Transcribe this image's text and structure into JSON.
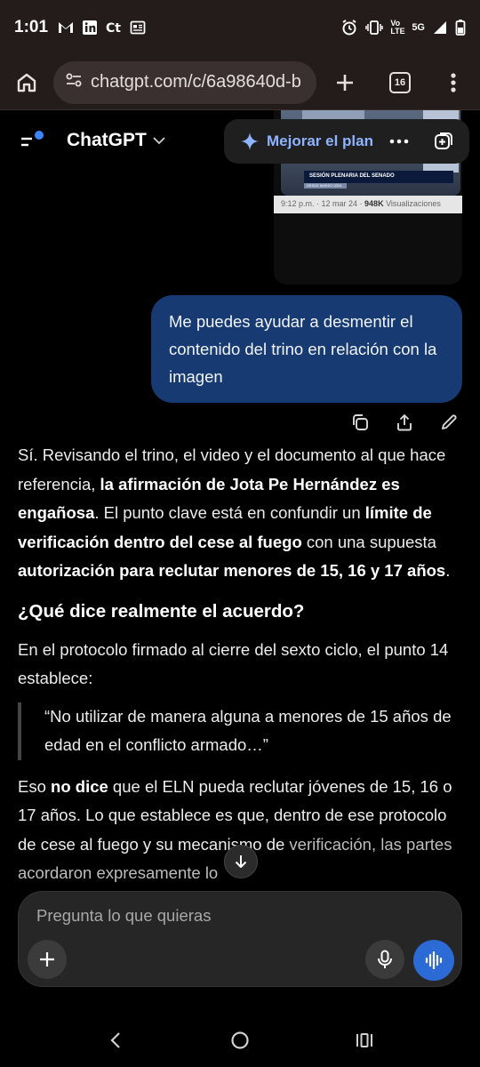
{
  "status_bar": {
    "time": "1:01",
    "notification_icons": [
      "gmail-icon",
      "linkedin-icon",
      "ct-icon",
      "news-icon"
    ],
    "network": "Vo LTE",
    "network_type": "5G"
  },
  "browser": {
    "url": "chatgpt.com/c/6a98640d-b",
    "tab_count": "16"
  },
  "chat_header": {
    "title": "ChatGPT",
    "upgrade_label": "Mejorar el plan",
    "accent_color": "#8eb4ff"
  },
  "tweet": {
    "lower_third": "SESIÓN PLENARIA DEL SENADO",
    "lower_sub": "DESDE MARZO 2024",
    "time": "9:12 p.m. · 12 mar 24 · ",
    "views_count": "948K",
    "views_label": " Visualizaciones"
  },
  "user_message": "Me puedes ayudar a desmentir el contenido del trino en relación con la imagen",
  "assistant": {
    "p1": {
      "a": "Sí. Revisando el trino, el video y el documento al que hace referencia, ",
      "b1": "la afirmación de Jota Pe Hernández es engañosa",
      "c": ". El punto clave está en confundir un ",
      "b2": "límite de verificación dentro del cese al fuego",
      "d": " con una supuesta ",
      "b3": "autorización para reclutar menores de 15, 16 y 17 años",
      "e": "."
    },
    "heading": "¿Qué dice realmente el acuerdo?",
    "p2": "En el protocolo firmado al cierre del sexto ciclo, el punto 14 establece:",
    "quote": "“No utilizar de manera alguna a menores de 15 años de edad en el conflicto armado…”",
    "p3": {
      "a": "Eso ",
      "b": "no dice",
      "c": " que el ELN pueda reclutar jóvenes de 15, 16 o 17 años. Lo que establece es que, dentro de ese protocolo de cese al fuego y su mecanismo de ",
      "d": "verificación, las partes acordaron expresamente lo"
    }
  },
  "composer": {
    "placeholder": "Pregunta lo que quieras"
  },
  "colors": {
    "user_bubble": "#173a72",
    "voice_button": "#2c6bd6",
    "browser_chrome": "#241b1b"
  }
}
